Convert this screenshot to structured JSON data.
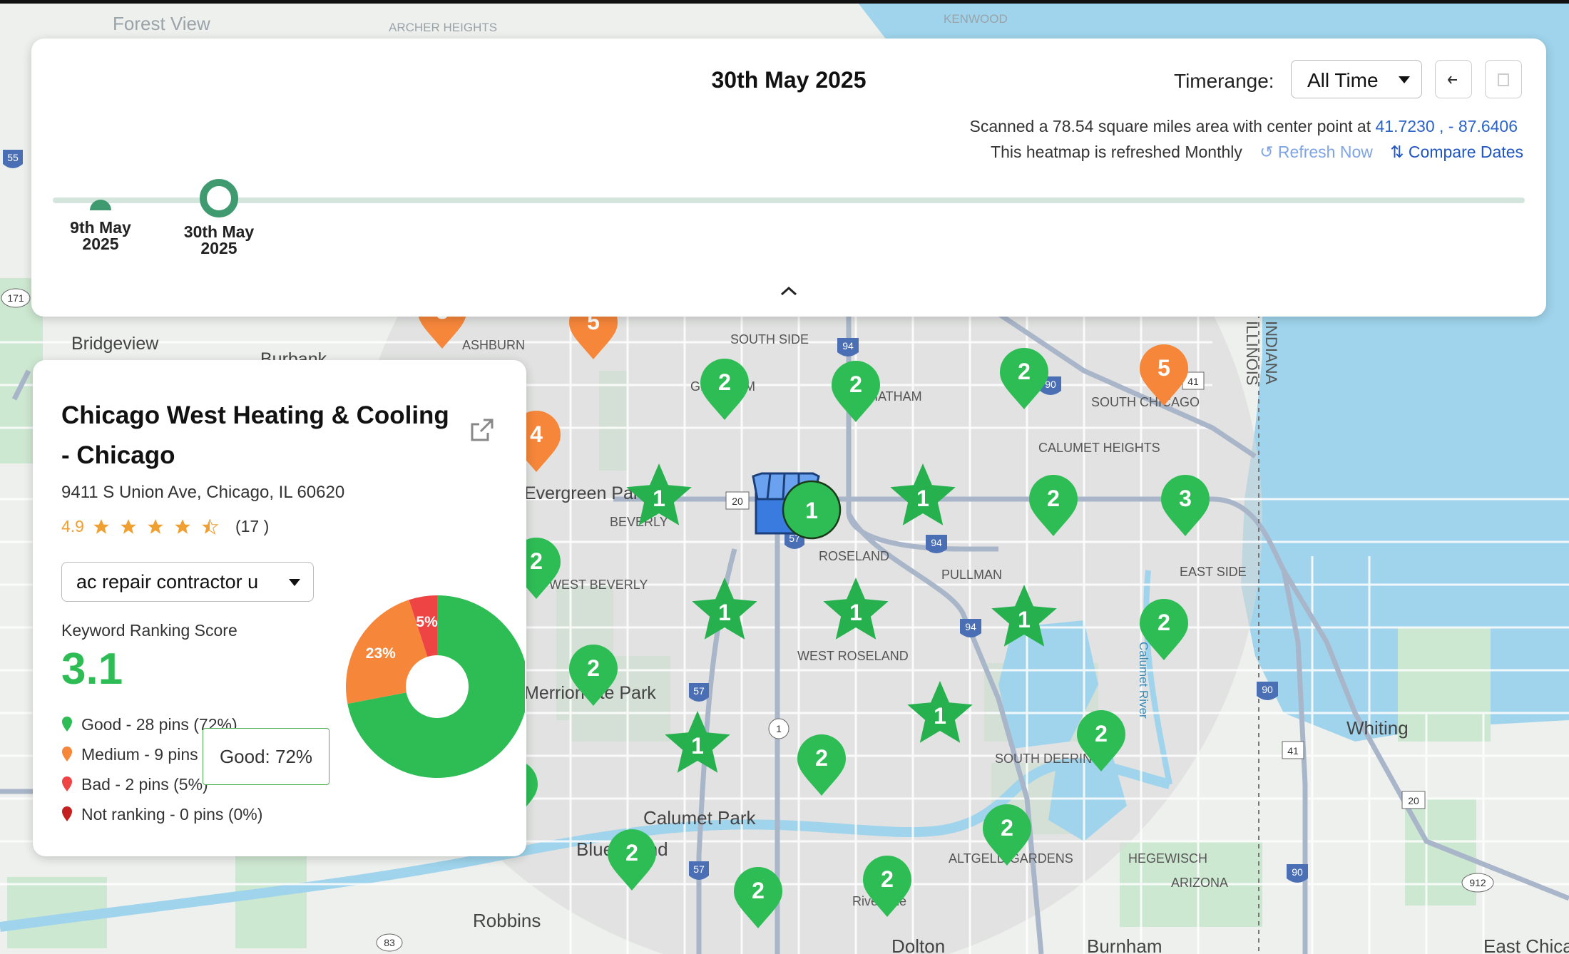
{
  "timeline": {
    "current_date": "30th May 2025",
    "timerange_label": "Timerange:",
    "timerange_value": "All Time",
    "scan_prefix": "Scanned a 78.54  square miles area with center point at",
    "lat": "41.7230",
    "lng": ", - 87.6406",
    "refresh_text": "This heatmap is refreshed Monthly",
    "refresh_now": "Refresh Now",
    "compare_dates": "Compare Dates",
    "dates": [
      {
        "line1": "9th May",
        "line2": "2025"
      },
      {
        "line1": "30th May",
        "line2": "2025"
      }
    ]
  },
  "business": {
    "name_line1": "Chicago West Heating & Cooling",
    "name_line2": "-  Chicago",
    "address": "9411   S Union Ave, Chicago, IL 60620",
    "rating": "4.9",
    "stars": 4.5,
    "review_count": "(17 )",
    "keyword": "ac repair contractor u",
    "score_label": "Keyword Ranking Score",
    "score": "3.1",
    "legend": [
      {
        "label": "Good -  28 pins (72%)",
        "color": "#2ebd55"
      },
      {
        "label": "Medium -  9 pins (23%)",
        "color": "#f5863a"
      },
      {
        "label": "Bad -  2 pins (5%)",
        "color": "#ee4444"
      },
      {
        "label": "Not ranking -  0 pins (0%)",
        "color": "#c42020"
      }
    ],
    "tooltip": "Good: 72%"
  },
  "chart_data": {
    "type": "pie",
    "categories": [
      "Good",
      "Medium",
      "Bad",
      "Not ranking"
    ],
    "values": [
      72,
      23,
      5,
      0
    ],
    "data_labels": [
      "",
      "23%",
      "5%",
      ""
    ],
    "colors": [
      "#2ebd55",
      "#f5863a",
      "#ee4444",
      "#c42020"
    ]
  },
  "map": {
    "colors": {
      "water": "#9fd4ec",
      "land": "#eef0ee",
      "park": "#cde8d1",
      "scan": "#d9d9d9",
      "good": "#2ebd55",
      "medium": "#f5863a",
      "star": "#27b14e"
    },
    "places": [
      "Forest View",
      "ARCHER HEIGHTS",
      "KENWOOD",
      "Bridgeview",
      "Burbank",
      "ASHBURN",
      "SOUTH SIDE",
      "CHATHAM",
      "SOUTH CHICAGO",
      "CALUMET HEIGHTS",
      "Evergreen Park",
      "BEVERLY",
      "ROSELAND",
      "PULLMAN",
      "EAST SIDE",
      "WEST BEVERLY",
      "WEST ROSELAND",
      "Merrionette Park",
      "Whiting",
      "SOUTH DEERING",
      "Calumet Park",
      "Blue Island",
      "HEGEWISCH",
      "ARIZONA",
      "ALTGELD GARDENS",
      "Robbins",
      "Riverdale",
      "Dolton",
      "Burnham",
      "East Chicago",
      "INDIANA",
      "ILLINOIS",
      "Calumet River",
      "GRESHAM"
    ],
    "pins": [
      {
        "type": "drop",
        "rank": "3",
        "color": "medium"
      },
      {
        "type": "drop",
        "rank": "5",
        "color": "medium"
      },
      {
        "type": "drop",
        "rank": "2",
        "color": "good"
      },
      {
        "type": "drop",
        "rank": "2",
        "color": "good"
      },
      {
        "type": "drop",
        "rank": "2",
        "color": "good"
      },
      {
        "type": "drop",
        "rank": "5",
        "color": "medium"
      },
      {
        "type": "drop",
        "rank": "4",
        "color": "medium"
      },
      {
        "type": "star",
        "rank": "1",
        "color": "star"
      },
      {
        "type": "circle",
        "rank": "1",
        "color": "good"
      },
      {
        "type": "star",
        "rank": "1",
        "color": "star"
      },
      {
        "type": "drop",
        "rank": "2",
        "color": "good"
      },
      {
        "type": "drop",
        "rank": "3",
        "color": "good"
      },
      {
        "type": "drop",
        "rank": "2",
        "color": "good"
      },
      {
        "type": "star",
        "rank": "1",
        "color": "star"
      },
      {
        "type": "star",
        "rank": "1",
        "color": "star"
      },
      {
        "type": "star",
        "rank": "1",
        "color": "star"
      },
      {
        "type": "drop",
        "rank": "2",
        "color": "good"
      },
      {
        "type": "drop",
        "rank": "2",
        "color": "good"
      },
      {
        "type": "star",
        "rank": "1",
        "color": "star"
      },
      {
        "type": "star",
        "rank": "1",
        "color": "star"
      },
      {
        "type": "drop",
        "rank": "2",
        "color": "good"
      },
      {
        "type": "drop",
        "rank": "2",
        "color": "good"
      },
      {
        "type": "drop",
        "rank": "3",
        "color": "good"
      },
      {
        "type": "drop",
        "rank": "2",
        "color": "good"
      },
      {
        "type": "drop",
        "rank": "2",
        "color": "good"
      },
      {
        "type": "drop",
        "rank": "2",
        "color": "good"
      },
      {
        "type": "drop",
        "rank": "2",
        "color": "good"
      }
    ],
    "shields": [
      "55",
      "171",
      "94",
      "90",
      "41",
      "20",
      "57",
      "94",
      "94",
      "57",
      "1",
      "90",
      "41",
      "20",
      "57",
      "90",
      "912",
      "83"
    ]
  }
}
